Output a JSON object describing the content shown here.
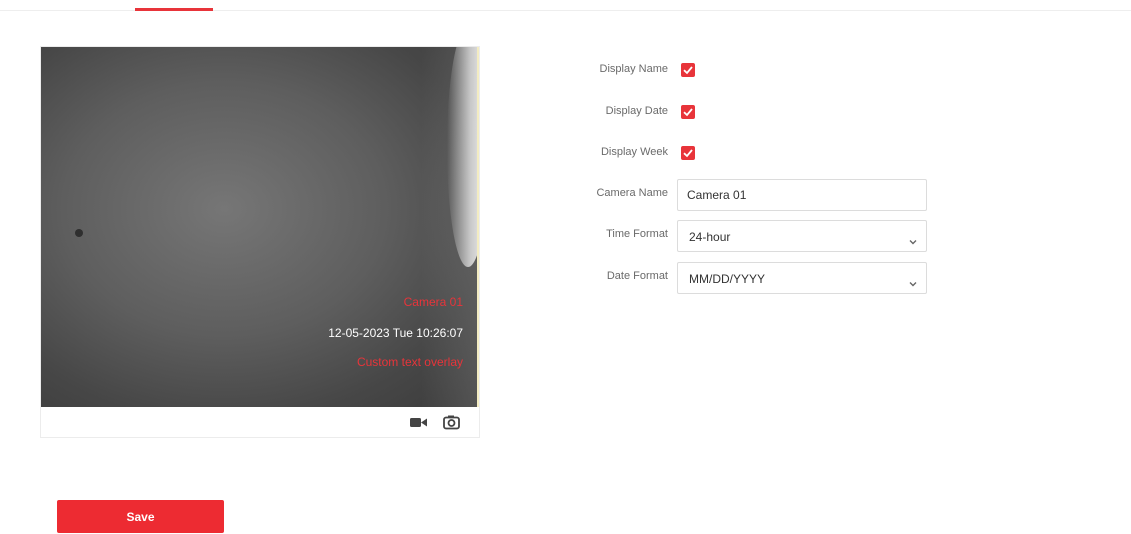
{
  "preview": {
    "osd_camera_name": "Camera 01",
    "osd_datetime": "12-05-2023 Tue 10:26:07",
    "osd_custom_text": "Custom text overlay"
  },
  "toolbar": {
    "record_icon": "video-camera-icon",
    "capture_icon": "camera-snapshot-icon"
  },
  "form": {
    "display_name_label": "Display Name",
    "display_name_checked": true,
    "display_date_label": "Display Date",
    "display_date_checked": true,
    "display_week_label": "Display Week",
    "display_week_checked": true,
    "camera_name_label": "Camera Name",
    "camera_name_value": "Camera 01",
    "time_format_label": "Time Format",
    "time_format_value": "24-hour",
    "date_format_label": "Date Format",
    "date_format_value": "MM/DD/YYYY"
  },
  "actions": {
    "save_label": "Save"
  },
  "colors": {
    "accent": "#ED2B32",
    "osd_red": "#E8343A"
  }
}
